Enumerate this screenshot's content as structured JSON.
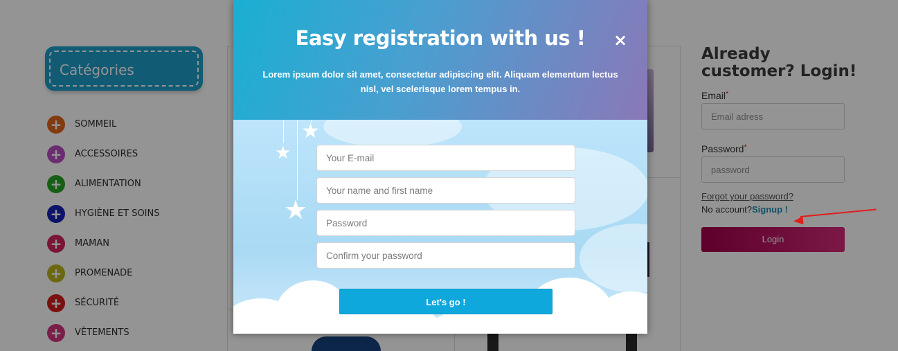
{
  "sidebar": {
    "title": "Catégories",
    "items": [
      {
        "label": "SOMMEIL",
        "color": "#e0661d"
      },
      {
        "label": "ACCESSOIRES",
        "color": "#b94fc4"
      },
      {
        "label": "ALIMENTATION",
        "color": "#27a424"
      },
      {
        "label": "HYGIÈNE ET SOINS",
        "color": "#1521b5"
      },
      {
        "label": "MAMAN",
        "color": "#d3255c"
      },
      {
        "label": "PROMENADE",
        "color": "#b8b31c"
      },
      {
        "label": "SÉCURITÉ",
        "color": "#d31e1e"
      },
      {
        "label": "VÊTEMENTS",
        "color": "#d2357f"
      }
    ]
  },
  "login": {
    "title": "Already customer? Login!",
    "email_label": "Email",
    "email_placeholder": "Email adress",
    "password_label": "Password",
    "password_placeholder": "password",
    "required_mark": "*",
    "forgot": "Forgot your password?",
    "no_account": "No account?",
    "signup": "Signup !",
    "button": "Login"
  },
  "modal": {
    "title": "Easy registration with us !",
    "subtitle": "Lorem ipsum dolor sit amet, consectetur adipiscing elit. Aliquam elementum lectus nisl, vel scelerisque lorem tempus in.",
    "close_icon": "×",
    "email_placeholder": "Your E-mail",
    "name_placeholder": "Your name and first name",
    "password_placeholder": "Password",
    "confirm_placeholder": "Confirm your password",
    "submit": "Let's go !"
  },
  "colors": {
    "accent_blue": "#0ea8dd",
    "login_button": "#c0185f",
    "annotation_arrow": "#e21d1d"
  }
}
